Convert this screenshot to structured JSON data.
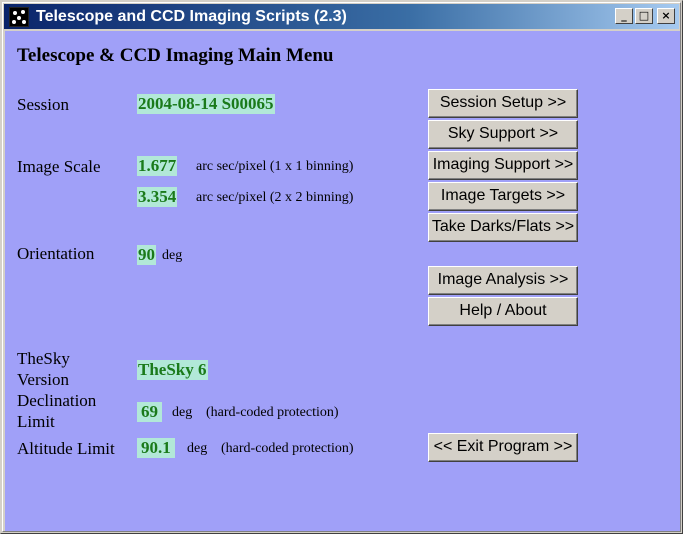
{
  "window": {
    "title": "Telescope and CCD Imaging Scripts (2.3)",
    "controls": {
      "minimize": "_",
      "maximize": "□",
      "close": "×"
    }
  },
  "main": {
    "heading": "Telescope & CCD Imaging Main Menu",
    "session": {
      "label": "Session",
      "value": "2004-08-14 S00065"
    },
    "image_scale": {
      "label": "Image Scale",
      "value1": "1.677",
      "unit1": "arc sec/pixel (1 x 1 binning)",
      "value2": "3.354",
      "unit2": "arc sec/pixel (2 x 2 binning)"
    },
    "orientation": {
      "label": "Orientation",
      "value": "90",
      "unit": "deg"
    },
    "thesky": {
      "label_line1": "TheSky",
      "label_line2": "Version",
      "value": "TheSky 6"
    },
    "declination": {
      "label_line1": "Declination",
      "label_line2": "Limit",
      "value": "69",
      "unit": "deg",
      "note": "(hard-coded protection)"
    },
    "altitude": {
      "label": "Altitude Limit",
      "value": "90.1",
      "unit": "deg",
      "note": "(hard-coded protection)"
    }
  },
  "buttons": {
    "session_setup": "Session Setup >>",
    "sky_support": "Sky Support >>",
    "imaging_support": "Imaging Support >>",
    "image_targets": "Image Targets >>",
    "take_darks_flats": "Take Darks/Flats >>",
    "image_analysis": "Image Analysis >>",
    "help_about": "Help / About",
    "exit_program": "<< Exit Program >>"
  },
  "colors": {
    "background": "#a0a0f8",
    "value_bg": "#b2e8d8",
    "value_text": "#1a7a1a",
    "titlebar_start": "#0a246a"
  }
}
